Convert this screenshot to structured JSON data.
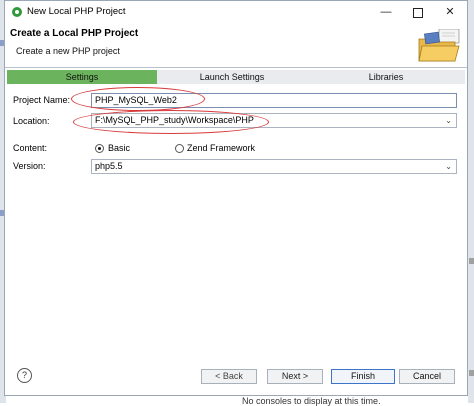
{
  "window": {
    "title": "New Local PHP Project",
    "controls": {
      "minimize": "—",
      "close": "✕"
    }
  },
  "header": {
    "title": "Create a Local PHP Project",
    "description": "Create a new PHP project"
  },
  "tabs": [
    {
      "label": "Settings",
      "active": true
    },
    {
      "label": "Launch Settings",
      "active": false
    },
    {
      "label": "Libraries",
      "active": false
    }
  ],
  "form": {
    "project_name_label": "Project Name:",
    "project_name_value": "PHP_MySQL_Web2",
    "location_label": "Location:",
    "location_value": "F:\\MySQL_PHP_study\\Workspace\\PHP",
    "content_label": "Content:",
    "content_options": [
      {
        "label": "Basic",
        "selected": true
      },
      {
        "label": "Zend Framework",
        "selected": false
      }
    ],
    "version_label": "Version:",
    "version_value": "php5.5"
  },
  "footer": {
    "help": "?",
    "back": "< Back",
    "next": "Next >",
    "finish": "Finish",
    "cancel": "Cancel"
  },
  "behind_text": "No consoles to display at this time.",
  "colors": {
    "active_tab": "#6cb35d",
    "annotation": "#d93a3a",
    "focus_border": "#3b74c8"
  }
}
